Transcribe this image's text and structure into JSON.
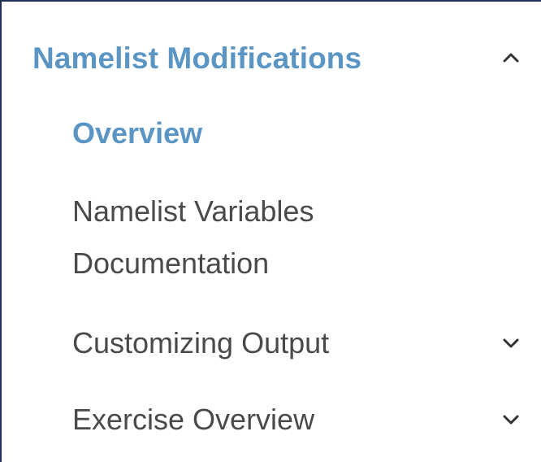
{
  "nav": {
    "section": {
      "title": "Namelist Modifications",
      "expanded": true,
      "toggle_icon": "chevron-up-icon"
    },
    "items": [
      {
        "label": "Overview",
        "active": true,
        "has_children": false
      },
      {
        "label": "Namelist Variables Documentation",
        "active": false,
        "has_children": false
      },
      {
        "label": "Customizing Output",
        "active": false,
        "has_children": true,
        "toggle_icon": "chevron-down-icon"
      },
      {
        "label": "Exercise Overview",
        "active": false,
        "has_children": true,
        "toggle_icon": "chevron-down-icon"
      }
    ]
  },
  "colors": {
    "accent": "#5b95c4",
    "text": "#4a4a4a",
    "border": "#1f2f57",
    "icon": "#333333"
  }
}
